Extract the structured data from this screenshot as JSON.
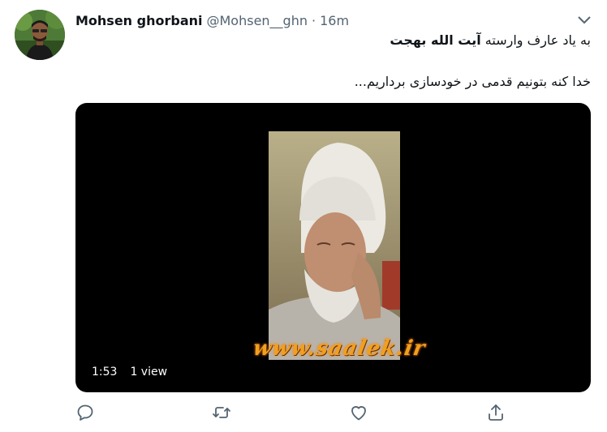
{
  "tweet": {
    "author_name": "Mohsen ghorbani",
    "author_handle": "@Mohsen__ghn",
    "separator": "·",
    "timestamp": "16m",
    "line1_prefix": "به یاد عارف وارسته ",
    "line1_bold": "آیت الله بهجت",
    "line2": "خدا کنه بتونیم قدمی در خودسازی برداریم..."
  },
  "video": {
    "duration": "1:53",
    "views": "1 view",
    "watermark": "www.saalek.ir"
  },
  "actions": {
    "reply_icon": "reply-icon",
    "retweet_icon": "retweet-icon",
    "like_icon": "heart-icon",
    "share_icon": "share-icon"
  },
  "colors": {
    "text_primary": "#0f1419",
    "text_secondary": "#536471",
    "video_background": "#000000",
    "watermark": "#f0a020"
  }
}
